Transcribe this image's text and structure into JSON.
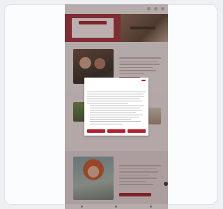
{
  "header": {
    "logo": "",
    "icons": [
      "search-icon",
      "user-icon",
      "menu-icon"
    ]
  },
  "hero": {
    "headline": "",
    "button_label": ""
  },
  "section_couple": {
    "title": "",
    "button_label": ""
  },
  "section_woman": {
    "title": "",
    "button_label": ""
  },
  "cookie_modal": {
    "logo": "",
    "title": "",
    "buttons": [
      "",
      "",
      ""
    ]
  },
  "bottom_nav": {
    "items": [
      "home-icon",
      "favorites-icon",
      "account-icon"
    ]
  },
  "colors": {
    "brand": "#a41f2c",
    "overlay": "rgba(60,40,40,0.35)",
    "page_bg": "#f3eeee"
  }
}
